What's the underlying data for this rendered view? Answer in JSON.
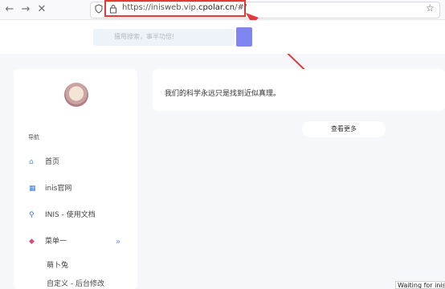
{
  "browser": {
    "url_prefix": "https://inisweb.vip.",
    "url_host": "cpolar.cn",
    "url_suffix": "/#/",
    "status": "Waiting for inis"
  },
  "search": {
    "placeholder": "擅用搜索，事半功倍!"
  },
  "sidebar": {
    "heading": "导航",
    "items": [
      {
        "label": "首页"
      },
      {
        "label": "inis官网"
      },
      {
        "label": "INIS - 使用文档"
      },
      {
        "label": "菜单一"
      }
    ],
    "sub_items": [
      {
        "label": "萌卜兔"
      },
      {
        "label": "自定义 - 后台修改"
      }
    ]
  },
  "content": {
    "quote": "我们的科学永远只是找到近似真理。",
    "more_label": "查看更多"
  },
  "colors": {
    "highlight": "#e53935",
    "search_button": "#7f86f2",
    "accent": "#6b8cf2"
  }
}
